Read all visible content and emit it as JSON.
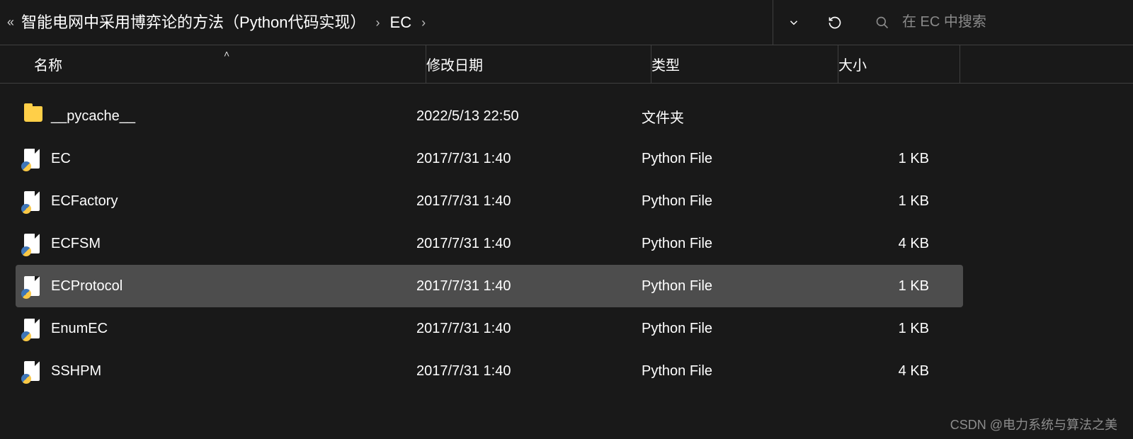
{
  "address": {
    "crumbs": [
      "智能电网中采用博弈论的方法（Python代码实现）",
      "EC"
    ]
  },
  "search": {
    "placeholder": "在 EC 中搜索"
  },
  "columns": {
    "name": "名称",
    "date": "修改日期",
    "type": "类型",
    "size": "大小"
  },
  "files": [
    {
      "kind": "folder",
      "name": "__pycache__",
      "date": "2022/5/13 22:50",
      "type": "文件夹",
      "size": "",
      "selected": false
    },
    {
      "kind": "py",
      "name": "EC",
      "date": "2017/7/31 1:40",
      "type": "Python File",
      "size": "1 KB",
      "selected": false
    },
    {
      "kind": "py",
      "name": "ECFactory",
      "date": "2017/7/31 1:40",
      "type": "Python File",
      "size": "1 KB",
      "selected": false
    },
    {
      "kind": "py",
      "name": "ECFSM",
      "date": "2017/7/31 1:40",
      "type": "Python File",
      "size": "4 KB",
      "selected": false
    },
    {
      "kind": "py",
      "name": "ECProtocol",
      "date": "2017/7/31 1:40",
      "type": "Python File",
      "size": "1 KB",
      "selected": true
    },
    {
      "kind": "py",
      "name": "EnumEC",
      "date": "2017/7/31 1:40",
      "type": "Python File",
      "size": "1 KB",
      "selected": false
    },
    {
      "kind": "py",
      "name": "SSHPM",
      "date": "2017/7/31 1:40",
      "type": "Python File",
      "size": "4 KB",
      "selected": false
    }
  ],
  "watermark": "CSDN @电力系统与算法之美"
}
